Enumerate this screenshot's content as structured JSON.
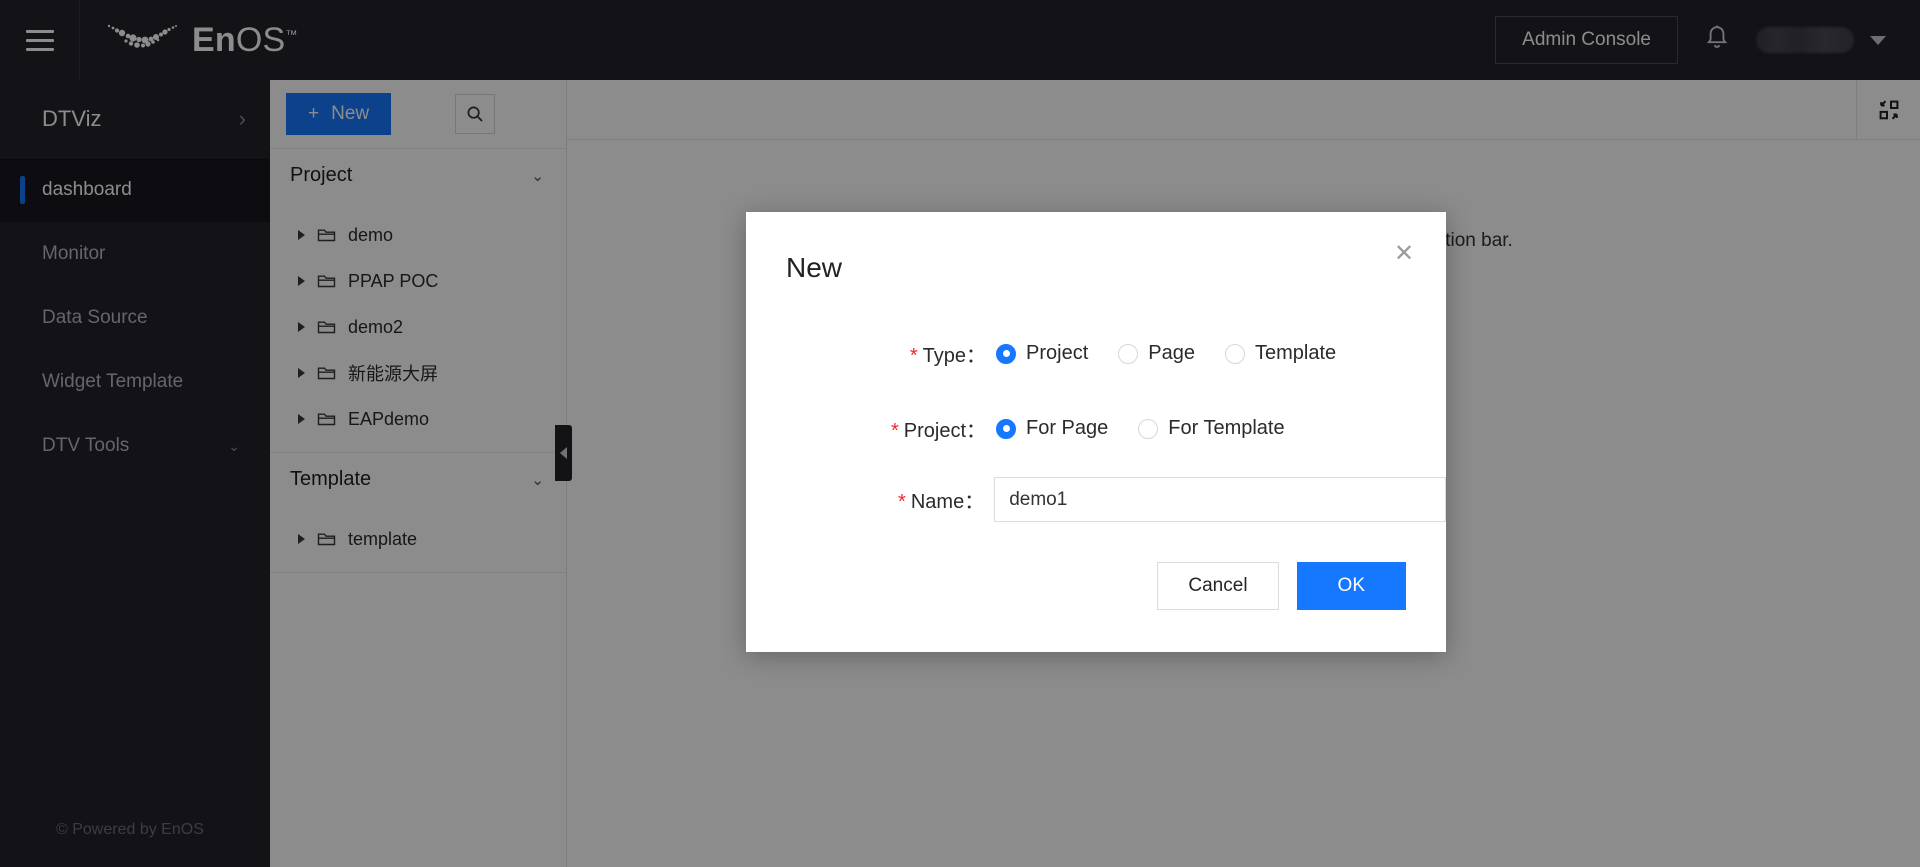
{
  "topnav": {
    "menu_icon": "hamburger-menu-icon",
    "brand_prefix": "En",
    "brand_suffix": "OS",
    "brand_tm": "™",
    "admin_console_label": "Admin Console",
    "notifications_icon": "bell-icon",
    "user_name": "",
    "user_caret_icon": "chevron-down-icon"
  },
  "sidebar": {
    "title": "DTViz",
    "expand_icon": "›",
    "items": [
      {
        "label": "dashboard",
        "active": true,
        "has_chevron": false
      },
      {
        "label": "Monitor",
        "active": false,
        "has_chevron": false
      },
      {
        "label": "Data Source",
        "active": false,
        "has_chevron": false
      },
      {
        "label": "Widget Template",
        "active": false,
        "has_chevron": false
      },
      {
        "label": "DTV Tools",
        "active": false,
        "has_chevron": true,
        "chevron": "⌄"
      }
    ],
    "footer": "© Powered by EnOS"
  },
  "tree": {
    "new_button_label": "New",
    "new_button_icon": "plus-icon",
    "search_icon": "search-icon",
    "collapse_handle_icon": "chevron-left-icon",
    "sections": [
      {
        "label": "Project",
        "chevron": "⌄",
        "nodes": [
          {
            "label": "demo",
            "icon": "folder-icon"
          },
          {
            "label": "PPAP POC",
            "icon": "folder-icon"
          },
          {
            "label": "demo2",
            "icon": "folder-icon"
          },
          {
            "label": "新能源大屏",
            "icon": "folder-icon"
          },
          {
            "label": "EAPdemo",
            "icon": "folder-icon"
          }
        ]
      },
      {
        "label": "Template",
        "chevron": "⌄",
        "nodes": [
          {
            "label": "template",
            "icon": "folder-icon"
          }
        ]
      }
    ]
  },
  "content": {
    "fullscreen_icon": "fullscreen-collapse-icon",
    "empty_hint": "Please create or select a dashboard from the left navigation bar."
  },
  "modal": {
    "title": "New",
    "close_icon": "close-icon",
    "fields": {
      "type": {
        "label": "Type：",
        "required_mark": "*",
        "options": [
          {
            "label": "Project",
            "selected": true
          },
          {
            "label": "Page",
            "selected": false
          },
          {
            "label": "Template",
            "selected": false
          }
        ]
      },
      "project": {
        "label": "Project：",
        "required_mark": "*",
        "options": [
          {
            "label": "For Page",
            "selected": true
          },
          {
            "label": "For Template",
            "selected": false
          }
        ]
      },
      "name": {
        "label": "Name：",
        "required_mark": "*",
        "value": "demo1",
        "placeholder": ""
      }
    },
    "cancel_label": "Cancel",
    "ok_label": "OK"
  },
  "colors": {
    "nav_dark": "#21212b",
    "accent_blue": "#1677ff",
    "required_red": "#f5222d"
  }
}
